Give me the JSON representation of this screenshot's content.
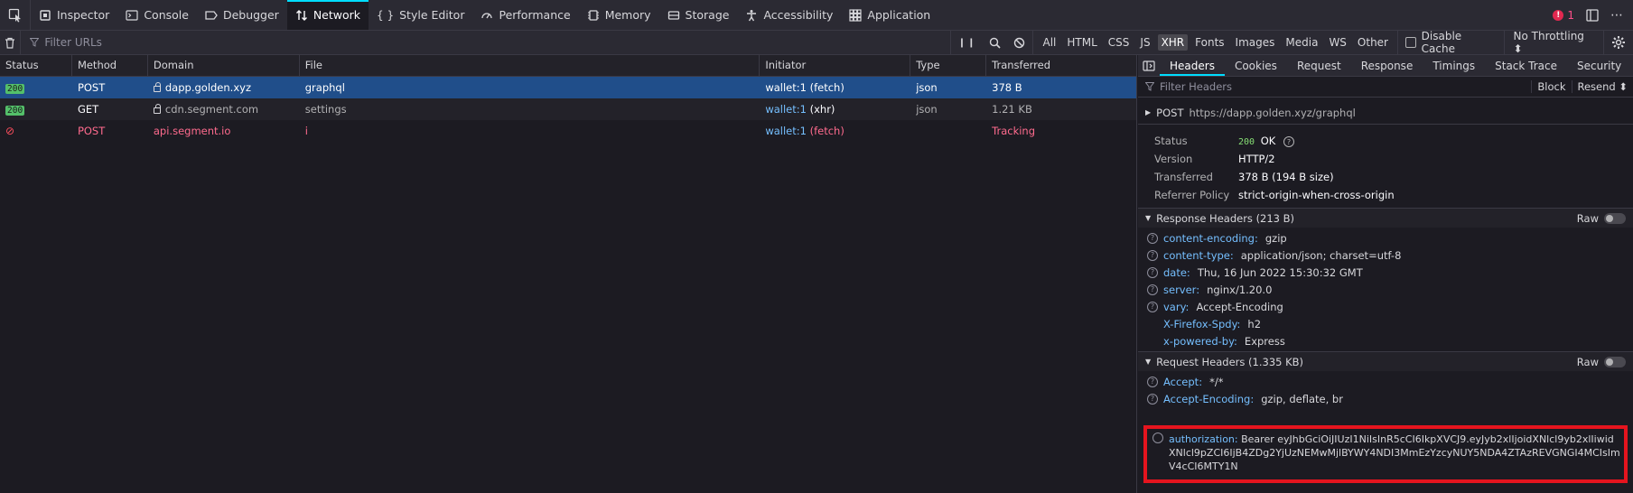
{
  "toolbar": {
    "tabs": [
      {
        "label": "Inspector",
        "icon": "inspector-icon"
      },
      {
        "label": "Console",
        "icon": "console-icon"
      },
      {
        "label": "Debugger",
        "icon": "debugger-icon"
      },
      {
        "label": "Network",
        "icon": "network-icon"
      },
      {
        "label": "Style Editor",
        "icon": "style-editor-icon"
      },
      {
        "label": "Performance",
        "icon": "performance-icon"
      },
      {
        "label": "Memory",
        "icon": "memory-icon"
      },
      {
        "label": "Storage",
        "icon": "storage-icon"
      },
      {
        "label": "Accessibility",
        "icon": "accessibility-icon"
      },
      {
        "label": "Application",
        "icon": "application-icon"
      }
    ],
    "error_count": "1"
  },
  "filterbar": {
    "filter_placeholder": "Filter URLs",
    "types": [
      "All",
      "HTML",
      "CSS",
      "JS",
      "XHR",
      "Fonts",
      "Images",
      "Media",
      "WS",
      "Other"
    ],
    "active_type": "XHR",
    "disable_cache": "Disable Cache",
    "throttling": "No Throttling ⬍"
  },
  "reqlist": {
    "columns": [
      "Status",
      "Method",
      "Domain",
      "File",
      "Initiator",
      "Type",
      "Transferred"
    ],
    "rows": [
      {
        "status": "200",
        "method": "POST",
        "domain": "dapp.golden.xyz",
        "file": "graphql",
        "initiator": "wallet:1",
        "initiator_kind": "(fetch)",
        "type": "json",
        "transferred": "378 B"
      },
      {
        "status": "200",
        "method": "GET",
        "domain": "cdn.segment.com",
        "file": "settings",
        "initiator": "wallet:1",
        "initiator_kind": "(xhr)",
        "type": "json",
        "transferred": "1.21 KB"
      },
      {
        "status": "",
        "method": "POST",
        "domain": "api.segment.io",
        "file": "i",
        "initiator": "wallet:1",
        "initiator_kind": "(fetch)",
        "type": "",
        "transferred": "Tracking"
      }
    ]
  },
  "side": {
    "tabs": [
      "Headers",
      "Cookies",
      "Request",
      "Response",
      "Timings",
      "Stack Trace",
      "Security"
    ],
    "filter_placeholder": "Filter Headers",
    "block_label": "Block",
    "resend_label": "Resend ⬍",
    "summary": {
      "method": "POST",
      "url": "https://dapp.golden.xyz/graphql"
    },
    "general": {
      "status_label": "Status",
      "status_code": "200",
      "status_text": "OK",
      "version_label": "Version",
      "version": "HTTP/2",
      "transferred_label": "Transferred",
      "transferred": "378 B (194 B size)",
      "referrer_label": "Referrer Policy",
      "referrer": "strict-origin-when-cross-origin"
    },
    "response_headers_title": "Response Headers (213 B)",
    "raw_label": "Raw",
    "response_headers": [
      {
        "name": "content-encoding:",
        "value": "gzip",
        "help": true
      },
      {
        "name": "content-type:",
        "value": "application/json; charset=utf-8",
        "help": true
      },
      {
        "name": "date:",
        "value": "Thu, 16 Jun 2022 15:30:32 GMT",
        "help": true
      },
      {
        "name": "server:",
        "value": "nginx/1.20.0",
        "help": true
      },
      {
        "name": "vary:",
        "value": "Accept-Encoding",
        "help": true
      },
      {
        "name": "X-Firefox-Spdy:",
        "value": "h2",
        "help": false
      },
      {
        "name": "x-powered-by:",
        "value": "Express",
        "help": false
      }
    ],
    "request_headers_title": "Request Headers (1.335 KB)",
    "request_headers": [
      {
        "name": "Accept:",
        "value": "*/*"
      },
      {
        "name": "Accept-Encoding:",
        "value": "gzip, deflate, br"
      }
    ],
    "authorization": {
      "name": "authorization:",
      "value": "Bearer eyJhbGciOiJIUzI1NiIsInR5cCI6IkpXVCJ9.eyJyb2xlIjoidXNlcl9yb2xlIiwidXNlcl9pZCI6IjB4ZDg2YjUzNEMwMjlBYWY4NDI3MmEzYzcyNUY5NDA4ZTAzREVGNGI4MCIsImV4cCI6MTY1N"
    }
  }
}
